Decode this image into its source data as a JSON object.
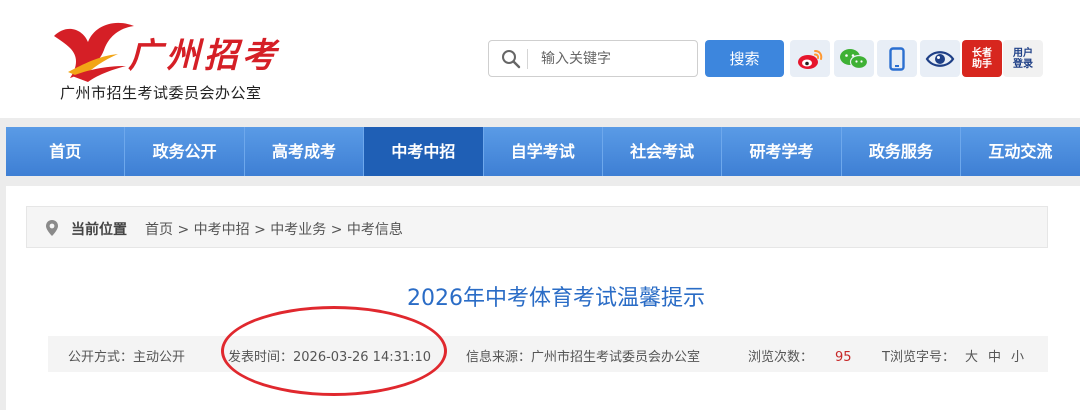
{
  "header": {
    "logo_script": "广州招考",
    "org_name": "广州市招生考试委员会办公室"
  },
  "search": {
    "placeholder": "输入关键字",
    "button_label": "搜索"
  },
  "toolbar": {
    "elder_helper_line1": "长者",
    "elder_helper_line2": "助手",
    "user_login_line1": "用户",
    "user_login_line2": "登录"
  },
  "nav": {
    "items": [
      "首页",
      "政务公开",
      "高考成考",
      "中考中招",
      "自学考试",
      "社会考试",
      "研考学考",
      "政务服务",
      "互动交流"
    ],
    "active_index": 3
  },
  "breadcrumb": {
    "label": "当前位置",
    "path": "首页 > 中考中招 > 中考业务 > 中考信息"
  },
  "article": {
    "title": "2026年中考体育考试温馨提示",
    "publish_mode": "公开方式：主动公开",
    "publish_time": "发表时间：2026-03-26 14:31:10",
    "source": "信息来源：广州市招生考试委员会办公室",
    "views_label": "浏览次数：",
    "views_count": "95",
    "font_size_label": "T浏览字号：",
    "font_sizes": [
      "大",
      "中",
      "小"
    ]
  },
  "colors": {
    "nav_blue": "#3e7fd4",
    "nav_active": "#1f5fb5",
    "title_blue": "#2a6cc6",
    "brand_red": "#d51f26",
    "annotation_red": "#e0282e"
  }
}
